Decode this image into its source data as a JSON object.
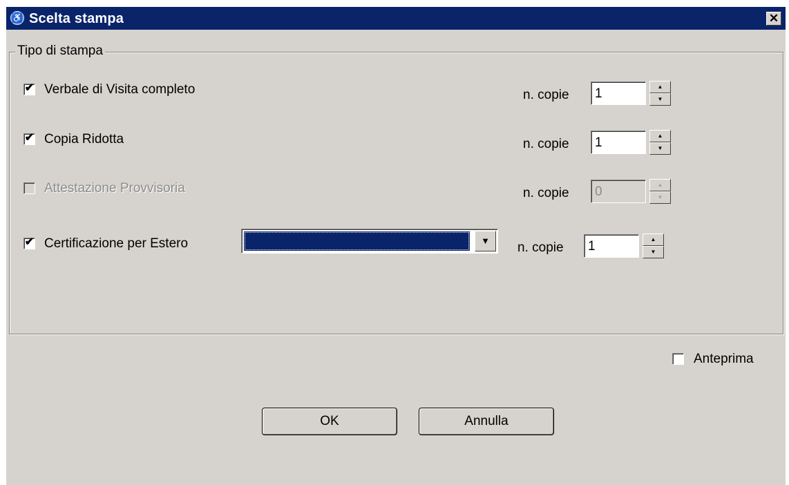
{
  "window": {
    "title": "Scelta stampa",
    "title_icon": "wheelchair-icon",
    "close_symbol": "✕"
  },
  "group": {
    "legend": "Tipo di stampa"
  },
  "rows": [
    {
      "label": "Verbale di Visita completo",
      "checked": true,
      "enabled": true,
      "copies_label": "n. copie",
      "copies": "1"
    },
    {
      "label": "Copia Ridotta",
      "checked": true,
      "enabled": true,
      "copies_label": "n. copie",
      "copies": "1"
    },
    {
      "label": "Attestazione Provvisoria",
      "checked": false,
      "enabled": false,
      "copies_label": "n. copie",
      "copies": "0"
    },
    {
      "label": "Certificazione per Estero",
      "checked": true,
      "enabled": true,
      "copies_label": "n. copie",
      "copies": "1"
    }
  ],
  "dropdown": {
    "selected_value": "",
    "arrow_symbol": "▼"
  },
  "spinner_symbols": {
    "up": "▲",
    "down": "▼"
  },
  "check_symbol": "✔",
  "preview": {
    "label": "Anteprima",
    "checked": false
  },
  "buttons": {
    "ok": "OK",
    "cancel": "Annulla"
  },
  "colors": {
    "titlebar": "#0a246a",
    "dialog_background": "#d6d3ce",
    "selection": "#0a246a",
    "disabled_text": "#8c8c8c"
  }
}
